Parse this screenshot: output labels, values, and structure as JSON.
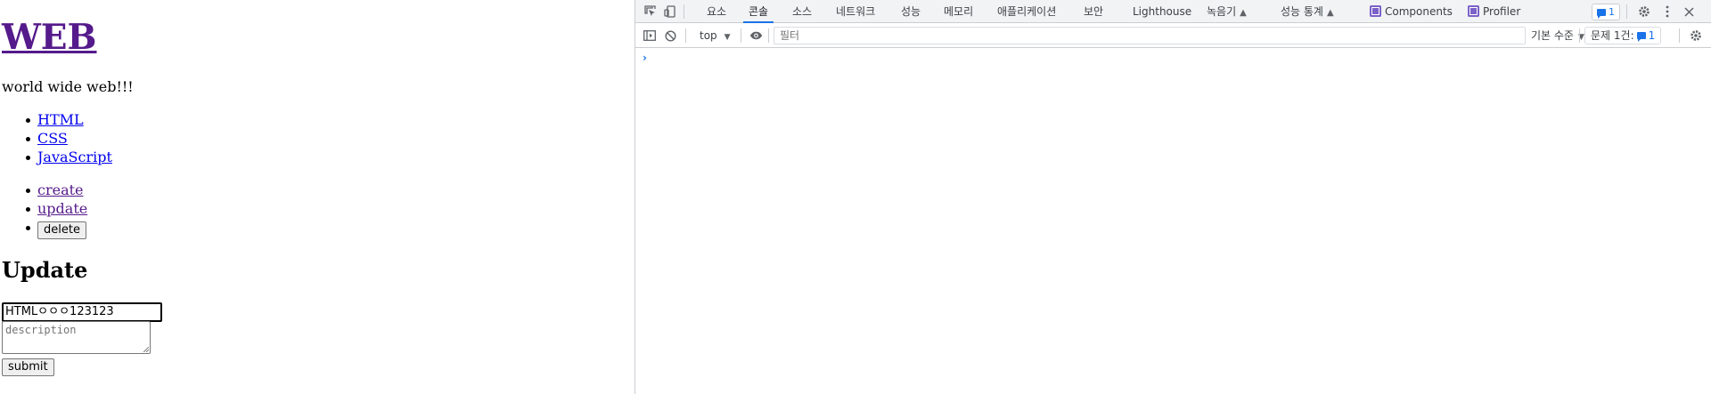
{
  "page": {
    "title": "WEB",
    "tagline": "world wide web!!!",
    "topics": [
      {
        "label": "HTML"
      },
      {
        "label": "CSS"
      },
      {
        "label": "JavaScript"
      }
    ],
    "controls": {
      "create_label": "create",
      "update_label": "update",
      "delete_label": "delete"
    },
    "form": {
      "heading": "Update",
      "title_value": "HTMLㅇㅇㅇ123123",
      "description_placeholder": "description",
      "submit_label": "submit"
    }
  },
  "devtools": {
    "tabs": [
      {
        "label": "요소"
      },
      {
        "label": "콘솔",
        "active": true
      },
      {
        "label": "소스"
      },
      {
        "label": "네트워크"
      },
      {
        "label": "성능"
      },
      {
        "label": "메모리"
      },
      {
        "label": "애플리케이션"
      },
      {
        "label": "보안"
      },
      {
        "label": "Lighthouse"
      },
      {
        "label": "녹음기"
      },
      {
        "label": "성능 통계"
      },
      {
        "label": "Components"
      },
      {
        "label": "Profiler"
      }
    ],
    "issues_badge": "1",
    "toolbar": {
      "context": "top",
      "filter_placeholder": "필터",
      "levels": "기본 수준",
      "issues_label": "문제 1건:",
      "issues_count": "1"
    },
    "icons": {
      "inspect": "inspect-icon",
      "device": "device-toggle-icon",
      "settings": "gear-icon",
      "menu": "kebab-menu-icon",
      "close": "close-icon",
      "sidebar": "sidebar-toggle-icon",
      "clear": "clear-console-icon",
      "live_expression": "eye-icon"
    },
    "colors": {
      "accent": "#1a73e8",
      "visited_link": "#551a8b",
      "link": "#0000ee"
    }
  }
}
